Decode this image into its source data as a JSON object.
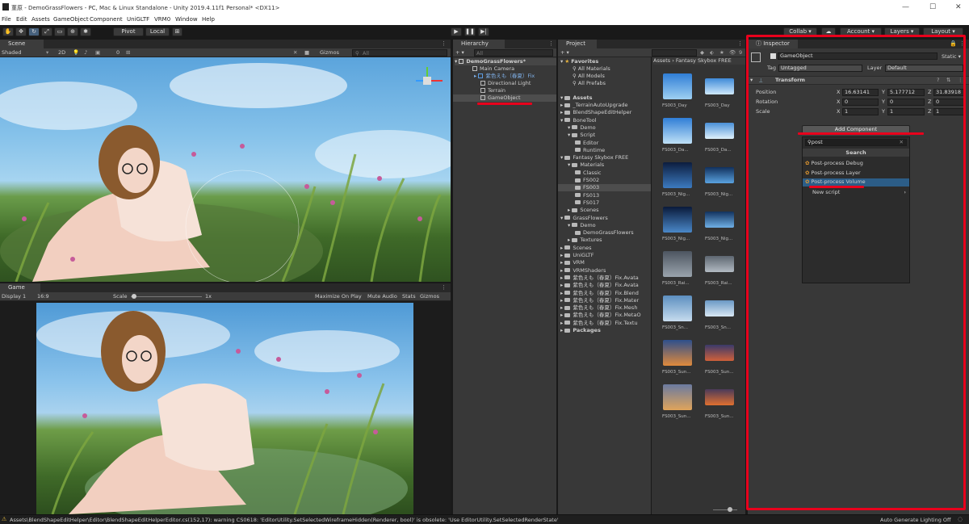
{
  "window": {
    "title": "菫原 - DemoGrassFlowers - PC, Mac & Linux Standalone - Unity 2019.4.11f1 Personal* <DX11>",
    "controls": [
      "—",
      "☐",
      "✕"
    ]
  },
  "menu": [
    "File",
    "Edit",
    "Assets",
    "GameObject",
    "Component",
    "UniGLTF",
    "VRM0",
    "Window",
    "Help"
  ],
  "toolbar": {
    "pivot": "Pivot",
    "local": "Local",
    "collab": "Collab ▾",
    "account": "Account ▾",
    "layers": "Layers ▾",
    "layout": "Layout ▾"
  },
  "scene": {
    "tab": "Scene",
    "shading": "Shaded",
    "mode": "2D",
    "gizmos": "Gizmos",
    "search_placeholder": "All",
    "layer_count": "0"
  },
  "game": {
    "tab": "Game",
    "display": "Display 1",
    "aspect": "16:9",
    "scale_label": "Scale",
    "scale_value": "1x",
    "maximize": "Maximize On Play",
    "mute": "Mute Audio",
    "stats": "Stats",
    "gizmos": "Gizmos"
  },
  "hierarchy": {
    "tab": "Hierarchy",
    "search_placeholder": "All",
    "scene_name": "DemoGrassFlowers*",
    "items": [
      "Main Camera",
      "紫色えも（春夏）Fix",
      "Directional Light",
      "Terrain",
      "GameObject"
    ]
  },
  "project": {
    "tab": "Project",
    "favorites_label": "Favorites",
    "favorites": [
      "All Materials",
      "All Models",
      "All Prefabs"
    ],
    "assets_label": "Assets",
    "tree": [
      {
        "label": "_TerrainAutoUpgrade",
        "depth": 1
      },
      {
        "label": "BlendShapeEditHelper",
        "depth": 1
      },
      {
        "label": "BoneTool",
        "depth": 1
      },
      {
        "label": "Demo",
        "depth": 2
      },
      {
        "label": "Script",
        "depth": 2
      },
      {
        "label": "Editor",
        "depth": 3
      },
      {
        "label": "Runtime",
        "depth": 3
      },
      {
        "label": "Fantasy Skybox FREE",
        "depth": 1
      },
      {
        "label": "Materials",
        "depth": 2
      },
      {
        "label": "Classic",
        "depth": 3
      },
      {
        "label": "FS002",
        "depth": 3
      },
      {
        "label": "FS003",
        "depth": 3
      },
      {
        "label": "FS013",
        "depth": 3
      },
      {
        "label": "FS017",
        "depth": 3
      },
      {
        "label": "Scenes",
        "depth": 2
      },
      {
        "label": "GrassFlowers",
        "depth": 1
      },
      {
        "label": "Demo",
        "depth": 2
      },
      {
        "label": "DemoGrassFlowers",
        "depth": 3
      },
      {
        "label": "Textures",
        "depth": 2
      },
      {
        "label": "Scenes",
        "depth": 1
      },
      {
        "label": "UniGLTF",
        "depth": 1
      },
      {
        "label": "VRM",
        "depth": 1
      },
      {
        "label": "VRMShaders",
        "depth": 1
      },
      {
        "label": "紫色えも（春夏）Fix.Avata",
        "depth": 1
      },
      {
        "label": "紫色えも（春夏）Fix.Avata",
        "depth": 1
      },
      {
        "label": "紫色えも（春夏）Fix.Blend",
        "depth": 1
      },
      {
        "label": "紫色えも（春夏）Fix.Mater",
        "depth": 1
      },
      {
        "label": "紫色えも（春夏）Fix.Mesh",
        "depth": 1
      },
      {
        "label": "紫色えも（春夏）Fix.MetaO",
        "depth": 1
      },
      {
        "label": "紫色えも（春夏）Fix.Textu",
        "depth": 1
      }
    ],
    "packages_label": "Packages",
    "breadcrumb": "Assets › Fantasy Skybox FREE",
    "thumbs": [
      "FS003_Day",
      "FS003_Day",
      "FS003_Da...",
      "FS003_Da...",
      "FS003_Nig...",
      "FS003_Nig...",
      "FS003_Nig...",
      "FS003_Nig...",
      "FS003_Rai...",
      "FS003_Rai...",
      "FS003_Sn...",
      "FS003_Sn...",
      "FS003_Sun...",
      "FS003_Sun...",
      "FS003_Sun...",
      "FS003_Sun..."
    ],
    "badge": "9"
  },
  "inspector": {
    "tab": "Inspector",
    "object_name": "GameObject",
    "static_label": "Static ▾",
    "tag_label": "Tag",
    "tag_value": "Untagged",
    "layer_label": "Layer",
    "layer_value": "Default",
    "transform_label": "Transform",
    "position_label": "Position",
    "rotation_label": "Rotation",
    "scale_label": "Scale",
    "position": {
      "x": "16.63141",
      "y": "5.177712",
      "z": "31.83918"
    },
    "rotation": {
      "x": "0",
      "y": "0",
      "z": "0"
    },
    "scale": {
      "x": "1",
      "y": "1",
      "z": "1"
    },
    "axis": {
      "x": "X",
      "y": "Y",
      "z": "Z"
    },
    "add_component": "Add Component",
    "search_value": "post",
    "search_header": "Search",
    "results": [
      "Post-process Debug",
      "Post-process Layer",
      "Post-process Volume"
    ],
    "new_script": "New script"
  },
  "status": {
    "message": "Assets\\BlendShapeEditHelper\\Editor\\BlendShapeEditHelperEditor.cs(152,17): warning CS0618: 'EditorUtility.SetSelectedWireframeHidden(Renderer, bool)' is obsolete: 'Use EditorUtility.SetSelectedRenderState'",
    "right": "Auto Generate Lighting Off"
  },
  "colors": {
    "highlight_red": "#e8001c",
    "selection_blue": "#2c5d87",
    "panel_bg": "#383838"
  }
}
